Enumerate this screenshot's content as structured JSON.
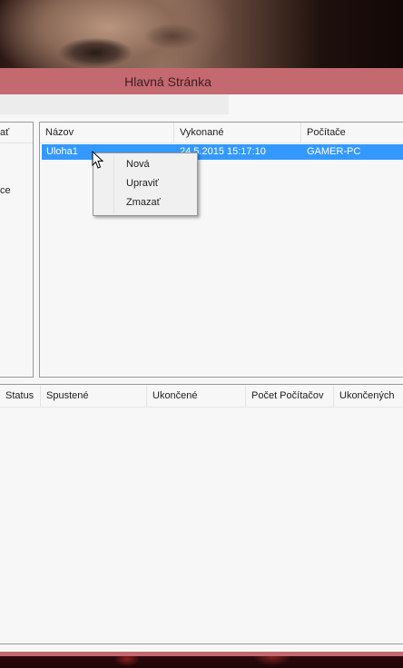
{
  "window": {
    "title": "Hlavná Stránka"
  },
  "left_panel": {
    "header_fragment": "ať",
    "item_fragment": "ce"
  },
  "tasks_list": {
    "columns": [
      "Názov",
      "Vykonané",
      "Počítače"
    ],
    "rows": [
      {
        "name": "Uloha1",
        "executed": "24.5.2015 15:17:10",
        "computers": "GAMER-PC",
        "selected": true
      }
    ]
  },
  "context_menu": {
    "items": [
      "Nová",
      "Upraviť",
      "Zmazať"
    ]
  },
  "runs_table": {
    "columns": [
      "Status",
      "Spustené",
      "Ukončené",
      "Počet Počítačov",
      "Ukončených"
    ]
  },
  "colors": {
    "title_bar": "#c4696f",
    "selection": "#3399ff",
    "background": "#f7f7f7"
  }
}
